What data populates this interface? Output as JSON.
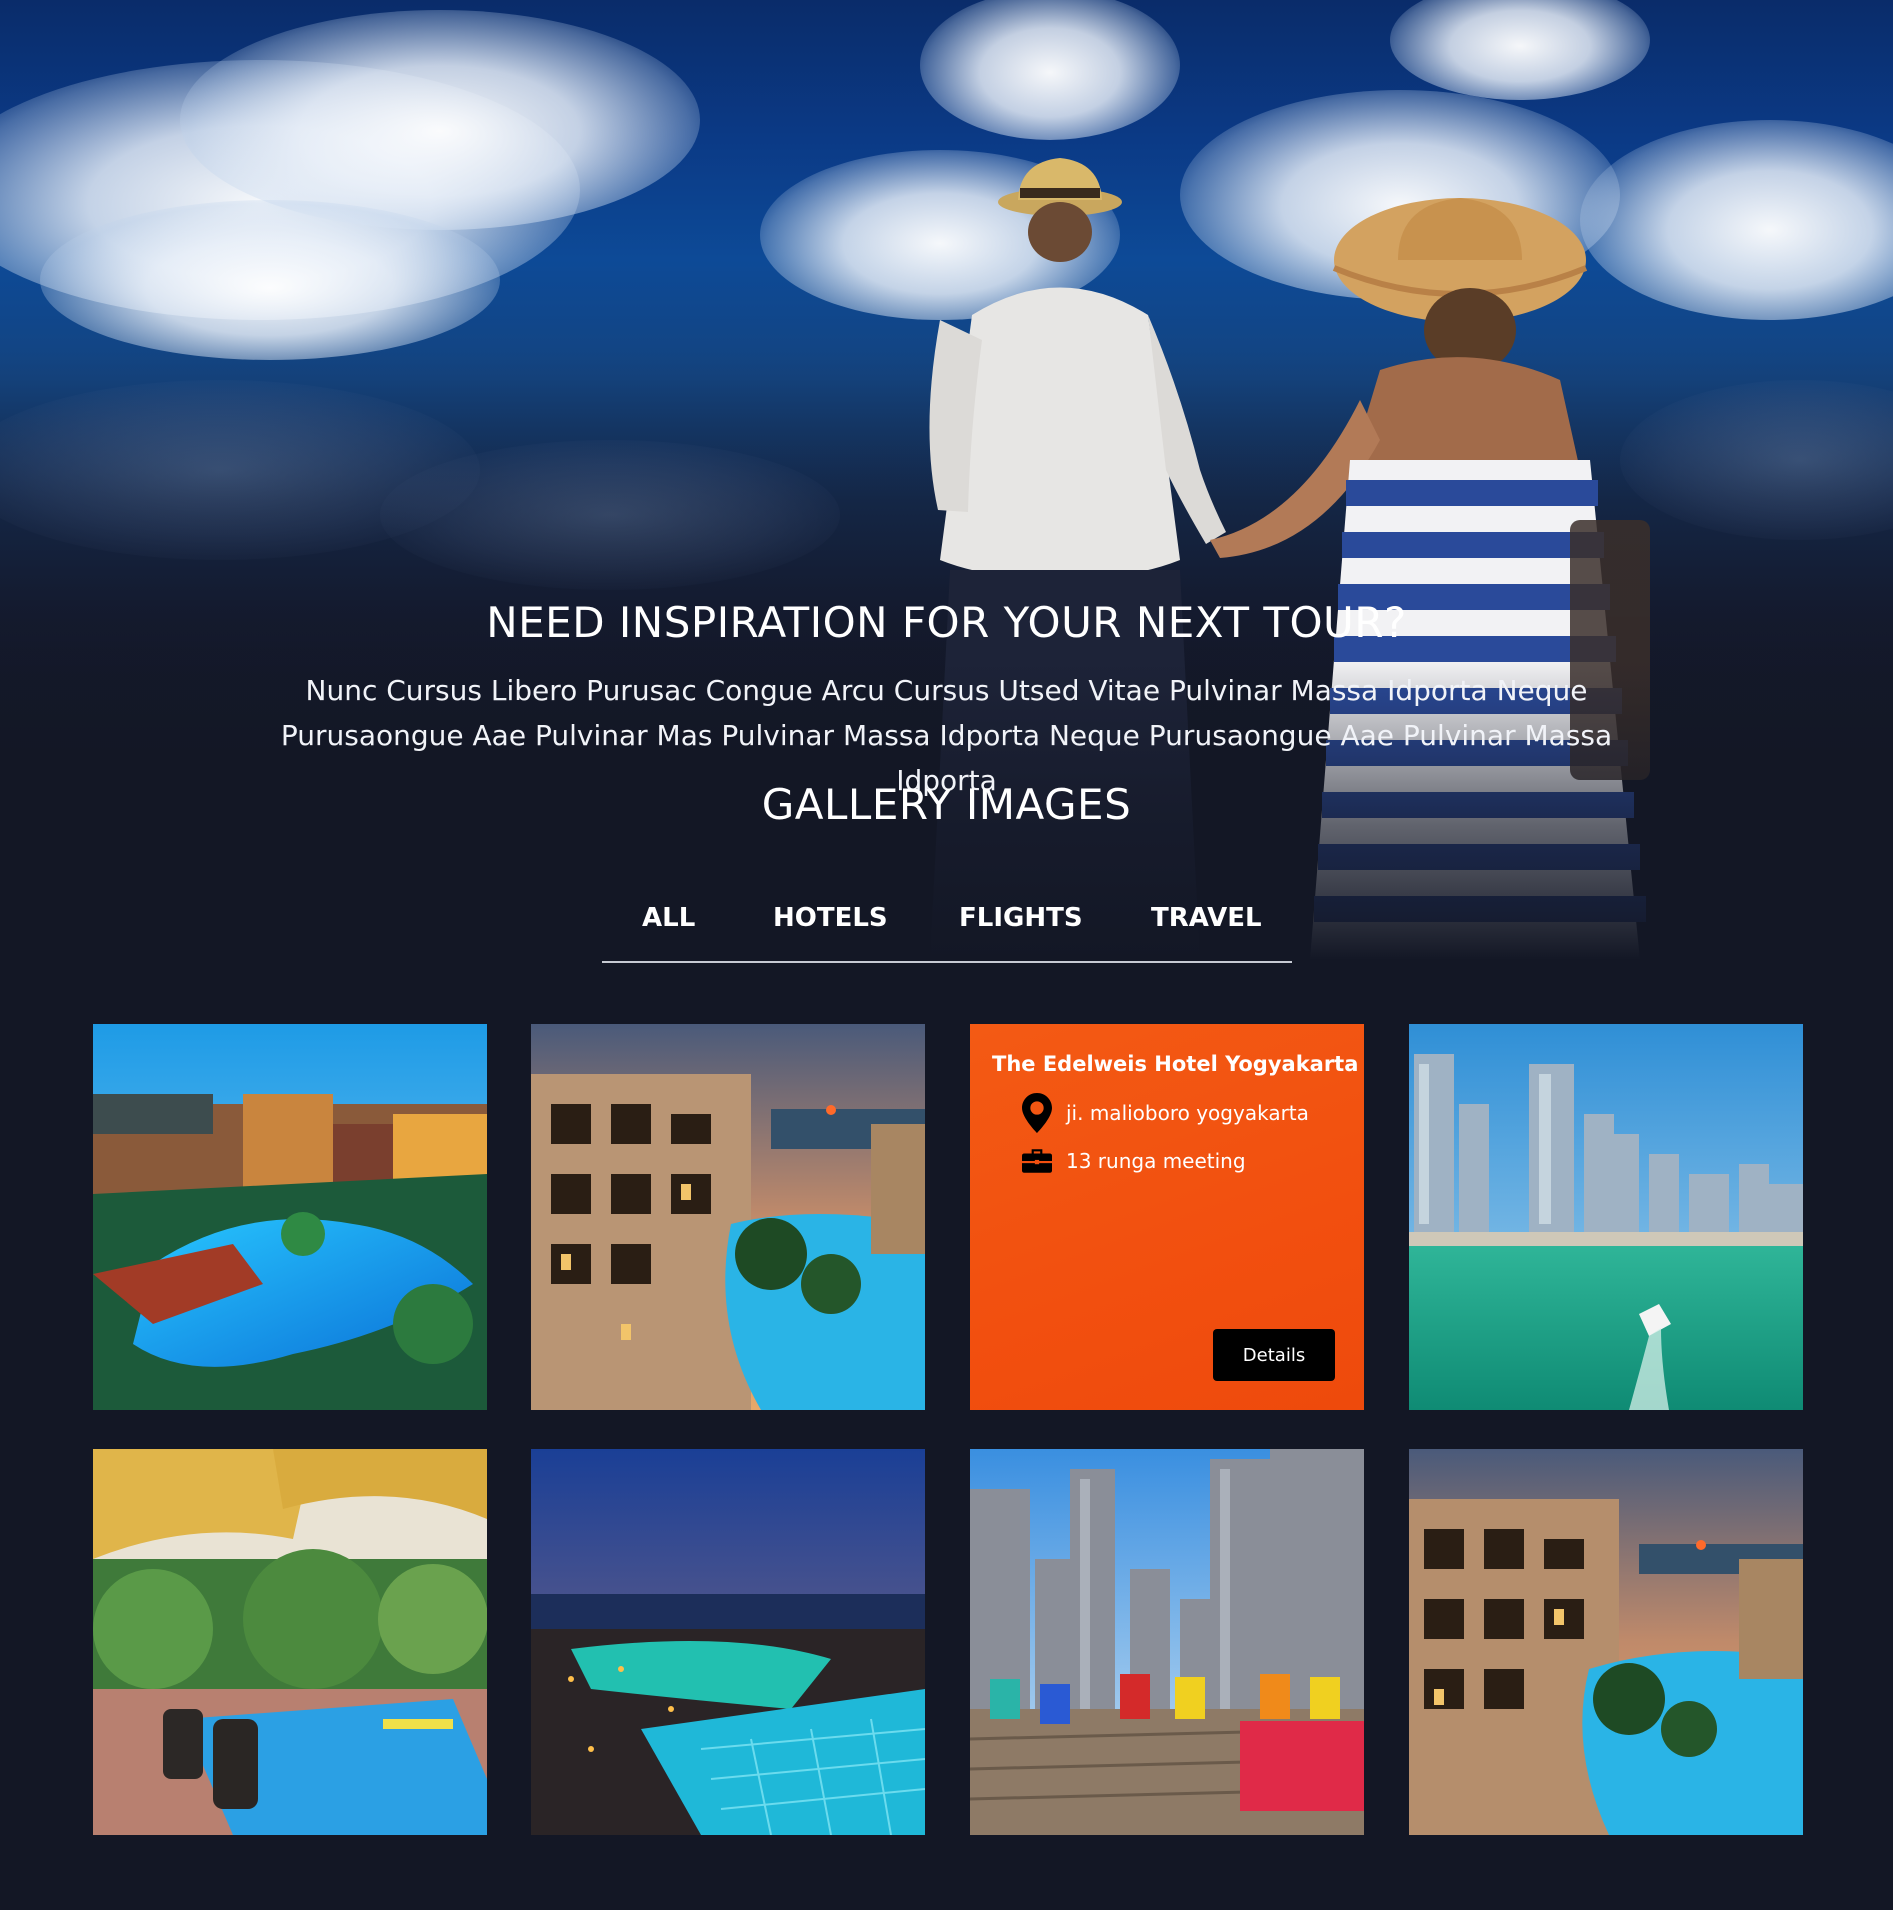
{
  "hero": {
    "title": "NEED INSPIRATION FOR YOUR NEXT TOUR?",
    "description": "Nunc Cursus Libero Purusac Congue Arcu Cursus Utsed Vitae Pulvinar Massa Idporta Neque Purusaongue Aae Pulvinar Mas Pulvinar Massa Idporta Neque Purusaongue Aae Pulvinar Massa Idporta"
  },
  "gallery": {
    "title": "GALLERY IMAGES",
    "tabs": [
      {
        "label": "ALL"
      },
      {
        "label": "HOTELS"
      },
      {
        "label": "FLIGHTS"
      },
      {
        "label": "TRAVEL"
      }
    ],
    "featured_card": {
      "title": "The Edelweis Hotel Yogyakarta",
      "location": "ji. malioboro yogyakarta",
      "meeting": "13 runga meeting",
      "button_label": "Details",
      "background_color": "#f24f0f"
    },
    "tile_icons": [
      "resort-pool-photo",
      "sunset-resort-photo",
      "hotel-card",
      "marina-skyline-photo",
      "tropical-pool-photo",
      "night-resort-photo",
      "rooftop-deck-photo",
      "resort-canal-photo"
    ]
  },
  "colors": {
    "page_background": "#131725",
    "accent_orange": "#f24f0f",
    "tab_underline": "#c7cad3"
  }
}
